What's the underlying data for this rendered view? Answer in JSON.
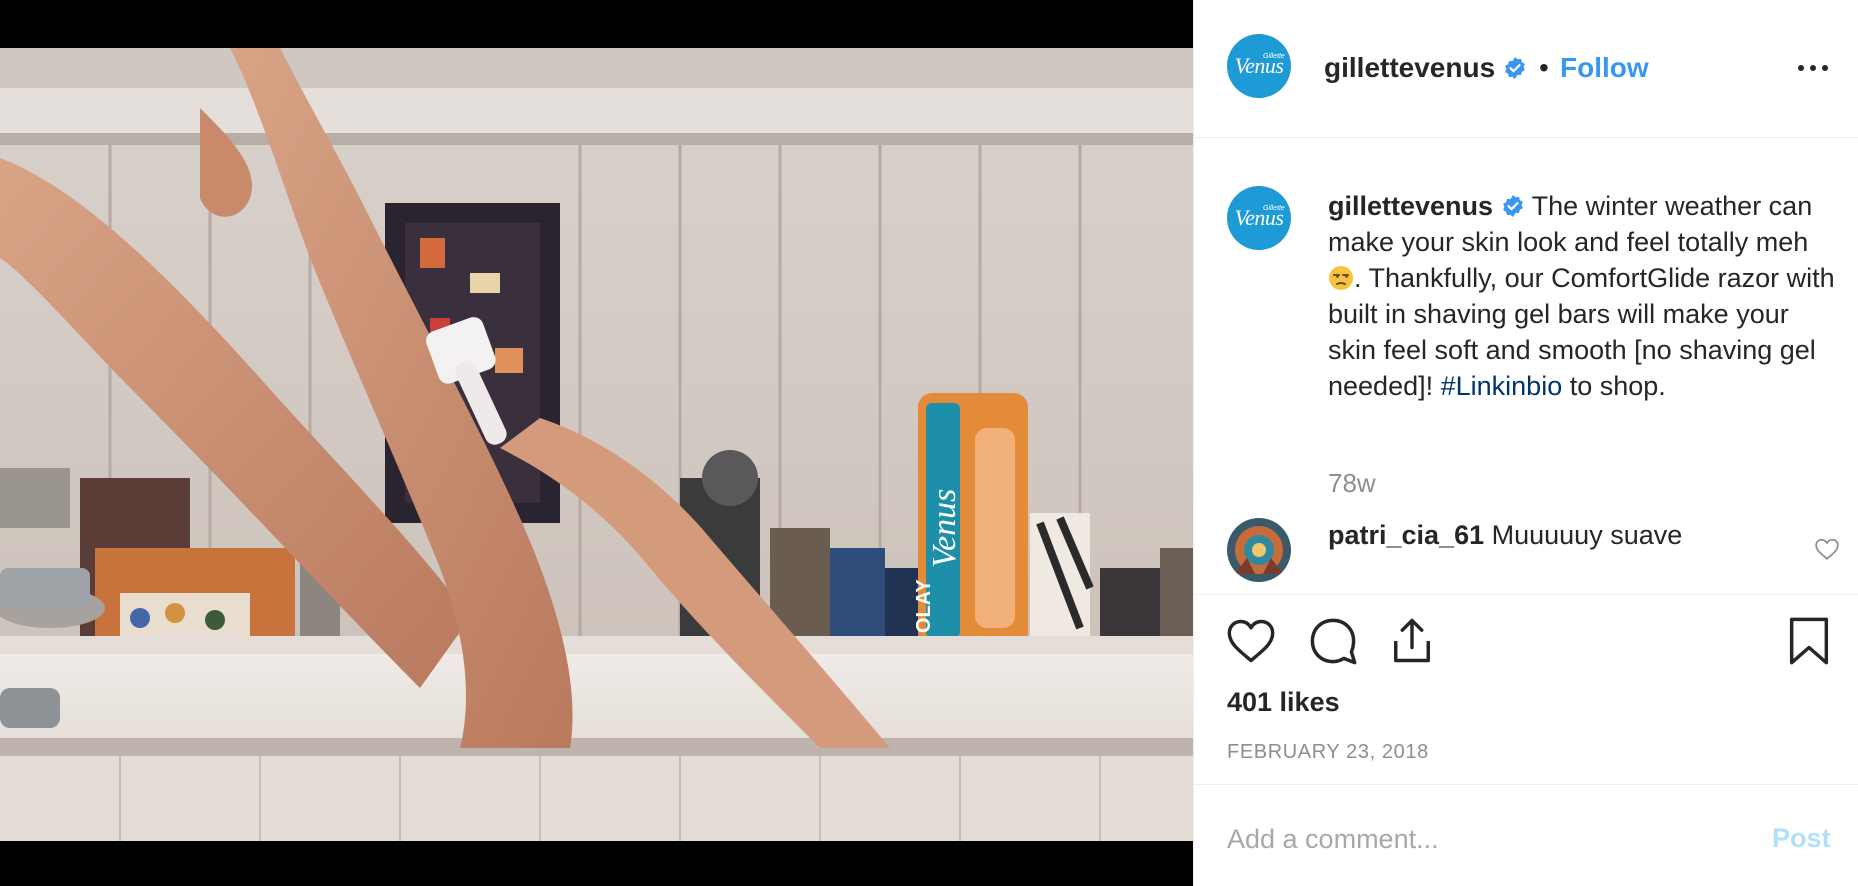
{
  "post_image": {
    "alt": "",
    "product_label": "Venus",
    "product_sublabel": "OLAY"
  },
  "header": {
    "username": "gillettevenus",
    "dot": "•",
    "follow_label": "Follow"
  },
  "brand": {
    "logo_text": "Venus",
    "logo_small": "Gillette",
    "color": "#1e9bd7"
  },
  "caption": {
    "username": "gillettevenus",
    "text_before_emoji": "The winter weather can make your skin look and feel totally meh",
    "text_after_emoji": ". Thankfully, our ComfortGlide razor with built in shaving gel bars will make your skin feel soft and smooth [no shaving gel needed]!",
    "hashtag": "#Linkinbio",
    "text_end": "to shop.",
    "time_ago": "78w"
  },
  "comments": [
    {
      "username": "patri_cia_61",
      "text": "Muuuuuy suave"
    }
  ],
  "likes": "401 likes",
  "date": "FEBRUARY 23, 2018",
  "add_comment": {
    "placeholder": "Add a comment...",
    "post_label": "Post"
  },
  "colors": {
    "link": "#3897f0",
    "hashtag": "#003569",
    "post_disabled": "#b2dffc",
    "verified": "#3897f0"
  }
}
